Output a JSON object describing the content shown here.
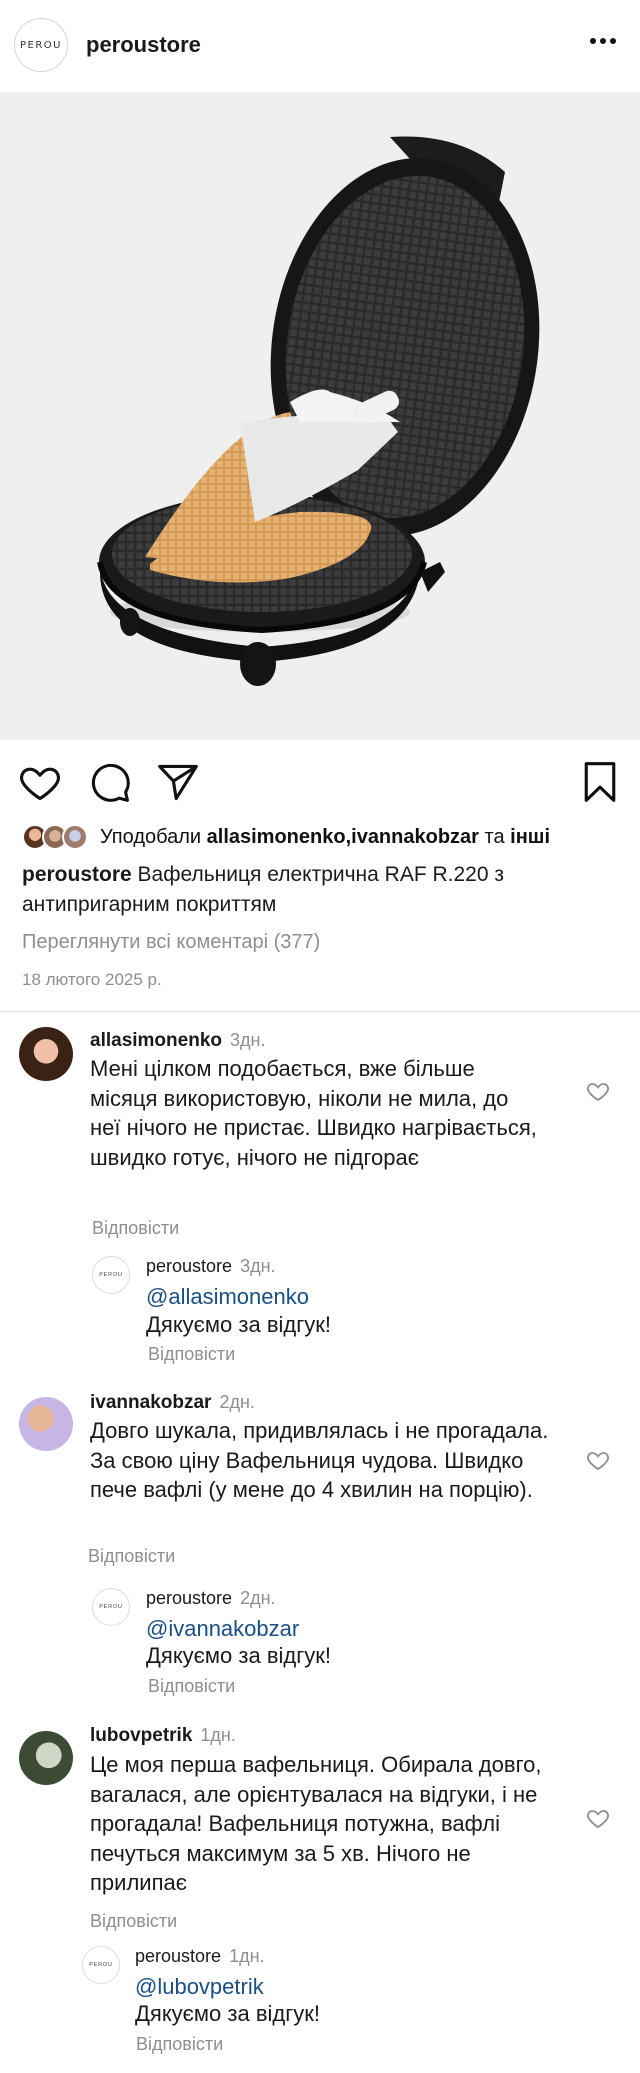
{
  "header": {
    "logo_text": "PEROU",
    "username": "peroustore",
    "more_icon": "more-horizontal-icon"
  },
  "post": {
    "likes": {
      "prefix": "Уподобали",
      "names": "allasimonenko,ivannakobzar",
      "and": "та",
      "others": "інші"
    },
    "caption": {
      "user": "peroustore",
      "text": "Вафельниця електрична RAF R.220 з антипригарним покриттям"
    },
    "view_all": "Переглянути всі коментарі (377)",
    "date": "18 лютого 2025 р."
  },
  "comments": [
    {
      "user": "allasimonenko",
      "time": "3дн.",
      "text": "Мені цілком подобається, вже більше місяця використовую, ніколи не мила, до неї нічого не пристає. Швидко нагрівається, швидко готує, нічого не підгорає",
      "reply_label": "Відповісти",
      "response": {
        "logo_text": "PEROU",
        "user": "peroustore",
        "time": "3дн.",
        "mention": "@allasimonenko",
        "text": "Дякуємо за відгук!",
        "reply_label": "Відповісти"
      }
    },
    {
      "user": "ivannakobzar",
      "time": "2дн.",
      "text": "Довго шукала, придивлялась і не прогадала. За свою ціну Вафельниця чудова. Швидко пече вафлі (у мене до 4 хвилин на порцію).",
      "reply_label": "Відповісти",
      "response": {
        "logo_text": "PEROU",
        "user": "peroustore",
        "time": "2дн.",
        "mention": "@ivannakobzar",
        "text": "Дякуємо за відгук!",
        "reply_label": "Відповісти"
      }
    },
    {
      "user": "lubovpetrik",
      "time": "1дн.",
      "text": "Це моя перша вафельниця. Обирала довго, вагалася, але орієнтувалася на відгуки, і не прогадала! Вафельниця потужна, вафлі печуться максимум за 5 хв. Нічого не прилипає",
      "reply_label": "Відповісти",
      "response": {
        "logo_text": "PEROU",
        "user": "peroustore",
        "time": "1дн.",
        "mention": "@lubovpetrik",
        "text": "Дякуємо за відгук!",
        "reply_label": "Відповісти"
      }
    }
  ],
  "colors": {
    "link_blue": "#1a4f85",
    "muted": "#8e8e8e",
    "divider": "#dbdbdb"
  }
}
